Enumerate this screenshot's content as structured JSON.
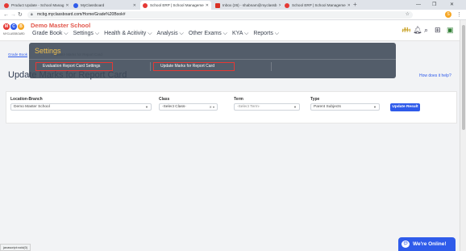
{
  "browser": {
    "tabs": [
      {
        "title": "Product Update - School Manag",
        "color": "#e53935",
        "active": false
      },
      {
        "title": "MyClassboard",
        "color": "#2f5bea",
        "active": false
      },
      {
        "title": "School ERP | School Manageme",
        "color": "#e53935",
        "active": true
      },
      {
        "title": "Inbox (26) - shabnam@myclassb",
        "color": "#d93025",
        "active": false
      },
      {
        "title": "School ERP | School Manageme",
        "color": "#e53935",
        "active": false
      }
    ],
    "new_tab": "+",
    "url": "mcbg.myclassboard.com/Home/Grade%20Book#",
    "profile_initial": "S"
  },
  "app": {
    "school_name": "Demo Master School",
    "logo_letters": [
      "M",
      "C",
      "B"
    ],
    "logo_caption": "MYCLASSBOARD",
    "menu": [
      "Grade Book ⌵",
      "Settings ⌵",
      "Health & Acitivity ⌵",
      "Analysis ⌵",
      "Other Exams ⌵",
      "KYA ⌵",
      "Reports ⌵"
    ]
  },
  "page": {
    "breadcrumb": "Grade Book",
    "breadcrumb_tail": "/ Update Marks for Report Card",
    "title": "Update Marks for Report Card",
    "help_link": "How does it help?"
  },
  "filters": {
    "location_label": "Location-Branch",
    "location_value": "Demo Master School",
    "class_label": "Class",
    "class_value": "-Select Class-",
    "term_label": "Term",
    "term_value": "-Select Term-",
    "type_label": "Type",
    "type_value": "Parent Subjects",
    "update_button": "Update Result"
  },
  "settings_menu": {
    "title": "Settings",
    "items": [
      "Evaluation Report Card Settings",
      "Update Marks for Report Card"
    ]
  },
  "status_url": "javascript:void(0)",
  "chat_widget": "We're Online!"
}
